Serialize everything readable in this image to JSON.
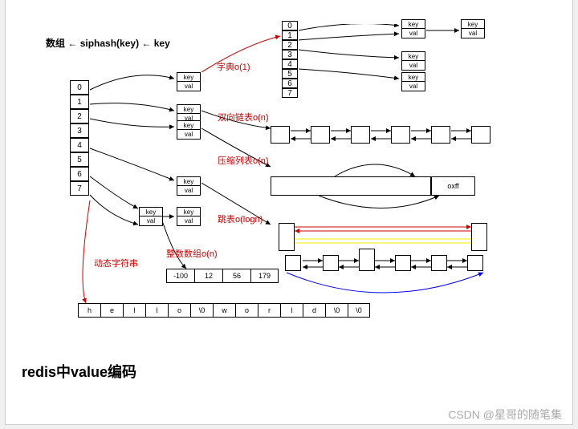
{
  "header": {
    "array_label": "数组",
    "hash_label": "siphash(key)",
    "arrow": "←",
    "key_label": "key"
  },
  "main_array": [
    "0",
    "1",
    "2",
    "3",
    "4",
    "5",
    "6",
    "7"
  ],
  "kv": {
    "key": "key",
    "val": "val"
  },
  "dict_label": "字典o(1)",
  "dict_array": [
    "0",
    "1",
    "2",
    "3",
    "4",
    "5",
    "6",
    "7"
  ],
  "linkedlist_label": "双向链表o(n)",
  "ziplist_label": "压缩列表o(n)",
  "ziplist_end": "oxff",
  "skiplist_label": "跳表o(logn)",
  "intarr_label": "整数数组o(n)",
  "intarr": [
    "-100",
    "12",
    "56",
    "179"
  ],
  "sds_label": "动态字符串",
  "sds": [
    "h",
    "e",
    "l",
    "l",
    "o",
    "\\0",
    "w",
    "o",
    "r",
    "l",
    "d",
    "\\0",
    "\\0"
  ],
  "title": "redis中value编码",
  "watermark": "CSDN @星哥的随笔集"
}
